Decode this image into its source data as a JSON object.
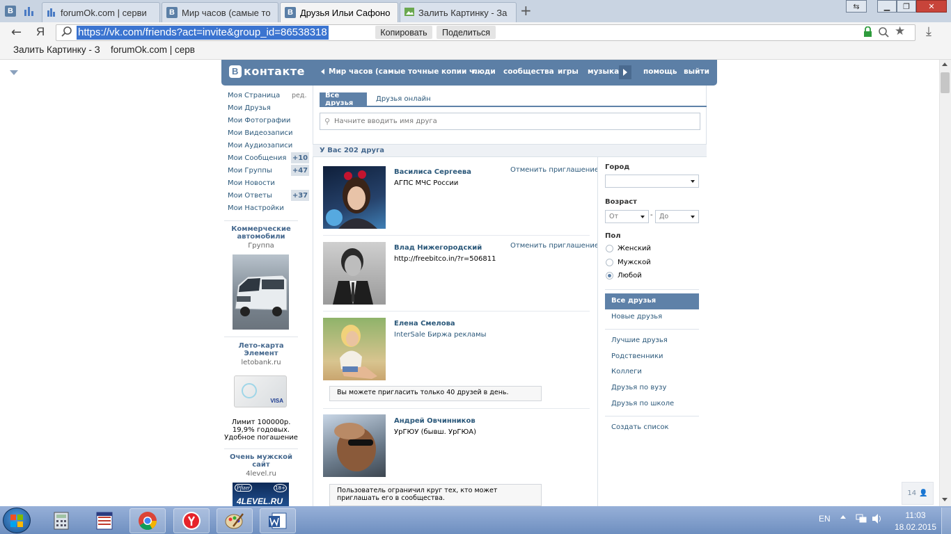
{
  "browser": {
    "tabs": [
      {
        "title": "forumOk.com | серви",
        "active": false
      },
      {
        "title": "Мир часов (самые то",
        "active": false
      },
      {
        "title": "Друзья Ильи Сафоно",
        "active": true
      },
      {
        "title": "Залить Картинку - За",
        "active": false
      }
    ],
    "url": "https://vk.com/friends?act=invite&group_id=86538318",
    "yandex_glyph": "Я",
    "copy_label": "Копировать",
    "share_label": "Поделиться",
    "bookmarks": [
      "Залить Картинку - З",
      "forumOk.com | серв"
    ]
  },
  "vk": {
    "logo_text": "контакте",
    "logo_letter": "В",
    "nav": {
      "group_link": "Мир часов (самые точные копии ч...",
      "people": "люди",
      "communities": "сообщества",
      "games": "игры",
      "music": "музыка",
      "help": "помощь",
      "logout": "выйти"
    },
    "left_menu": [
      {
        "label": "Моя Страница",
        "extra": "ред."
      },
      {
        "label": "Мои Друзья",
        "extra": ""
      },
      {
        "label": "Мои Фотографии",
        "extra": ""
      },
      {
        "label": "Мои Видеозаписи",
        "extra": ""
      },
      {
        "label": "Мои Аудиозаписи",
        "extra": ""
      },
      {
        "label": "Мои Сообщения",
        "extra": "+10"
      },
      {
        "label": "Мои Группы",
        "extra": "+47"
      },
      {
        "label": "Мои Новости",
        "extra": ""
      },
      {
        "label": "Мои Ответы",
        "extra": "+37"
      },
      {
        "label": "Мои Настройки",
        "extra": ""
      }
    ],
    "ads": [
      {
        "title": "Коммерческие автомобили",
        "sub": "Группа",
        "text": ""
      },
      {
        "title": "Лето-карта Элемент",
        "sub": "letobank.ru",
        "text": "Лимит 100000р. 19,9% годовых. Удобное погашение",
        "card_brand": "VISA"
      },
      {
        "title": "Очень мужской сайт",
        "sub": "4level.ru",
        "text": "",
        "banner_text": "4LEVEL.RU",
        "brand": "Pfizer",
        "age": "18+"
      }
    ],
    "tabs": {
      "all": "Все друзья",
      "online": "Друзья онлайн"
    },
    "search_placeholder": "Начните вводить имя друга",
    "summary": "У Вас 202 друга",
    "friends": [
      {
        "name": "Василиса Сергеева",
        "sub": "АГПС МЧС России",
        "action": "Отменить приглашение"
      },
      {
        "name": "Влад Нижегородский",
        "sub": "http://freebitco.in/?r=506811",
        "action": "Отменить приглашение"
      },
      {
        "name": "Елена Смелова",
        "sub": "InterSale Биржа рекламы",
        "note": "Вы можете пригласить только 40 друзей в день."
      },
      {
        "name": "Андрей Овчинников",
        "sub": "УрГЮУ (бывш. УрГЮА)",
        "note": "Пользователь ограничил круг тех, кто может приглашать его в сообщества."
      }
    ],
    "filters": {
      "city_label": "Город",
      "age_label": "Возраст",
      "age_from": "От",
      "age_to": "До",
      "age_dash": "-",
      "sex_label": "Пол",
      "sex_options": [
        "Женский",
        "Мужской",
        "Любой"
      ],
      "sex_selected": "Любой",
      "lists": [
        "Все друзья",
        "Новые друзья",
        "Лучшие друзья",
        "Родственники",
        "Коллеги",
        "Друзья по вузу",
        "Друзья по школе"
      ],
      "create_list": "Создать список"
    },
    "online_counter": "14"
  },
  "taskbar": {
    "lang": "EN",
    "time": "11:03",
    "date": "18.02.2015",
    "apps": [
      "calculator",
      "notepad",
      "chrome",
      "yandex",
      "paint",
      "word"
    ]
  },
  "colors": {
    "vk_blue": "#5c7fa6",
    "link": "#2b587a",
    "taskbar": "#7f9dcc"
  }
}
